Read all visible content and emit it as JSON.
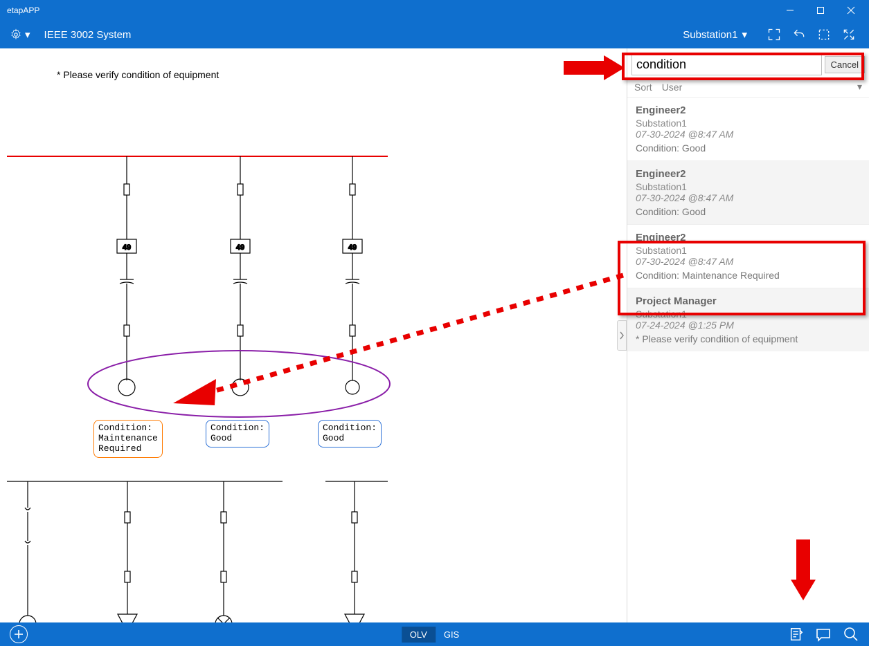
{
  "window": {
    "title": "etapAPP"
  },
  "toolbar": {
    "project": "IEEE 3002 System",
    "substation": "Substation1"
  },
  "canvas": {
    "notice": "* Please verify condition of equipment",
    "equipment_tag": "49",
    "labels": {
      "l1_line1": "Condition:",
      "l1_line2": "Maintenance",
      "l1_line3": "Required",
      "l2_line1": "Condition:",
      "l2_line2": "Good",
      "l3_line1": "Condition:",
      "l3_line2": "Good"
    }
  },
  "search": {
    "value": "condition",
    "cancel": "Cancel"
  },
  "sort": {
    "label": "Sort",
    "value": "User"
  },
  "comments": [
    {
      "author": "Engineer2",
      "location": "Substation1",
      "timestamp": "07-30-2024 @8:47 AM",
      "body": "Condition: Good"
    },
    {
      "author": "Engineer2",
      "location": "Substation1",
      "timestamp": "07-30-2024 @8:47 AM",
      "body": "Condition: Good"
    },
    {
      "author": "Engineer2",
      "location": "Substation1",
      "timestamp": "07-30-2024 @8:47 AM",
      "body": "Condition: Maintenance Required"
    },
    {
      "author": "Project Manager",
      "location": "Substation1",
      "timestamp": "07-24-2024 @1:25 PM",
      "body": "* Please verify condition of equipment"
    }
  ],
  "bottombar": {
    "tab_olv": "OLV",
    "tab_gis": "GIS"
  }
}
